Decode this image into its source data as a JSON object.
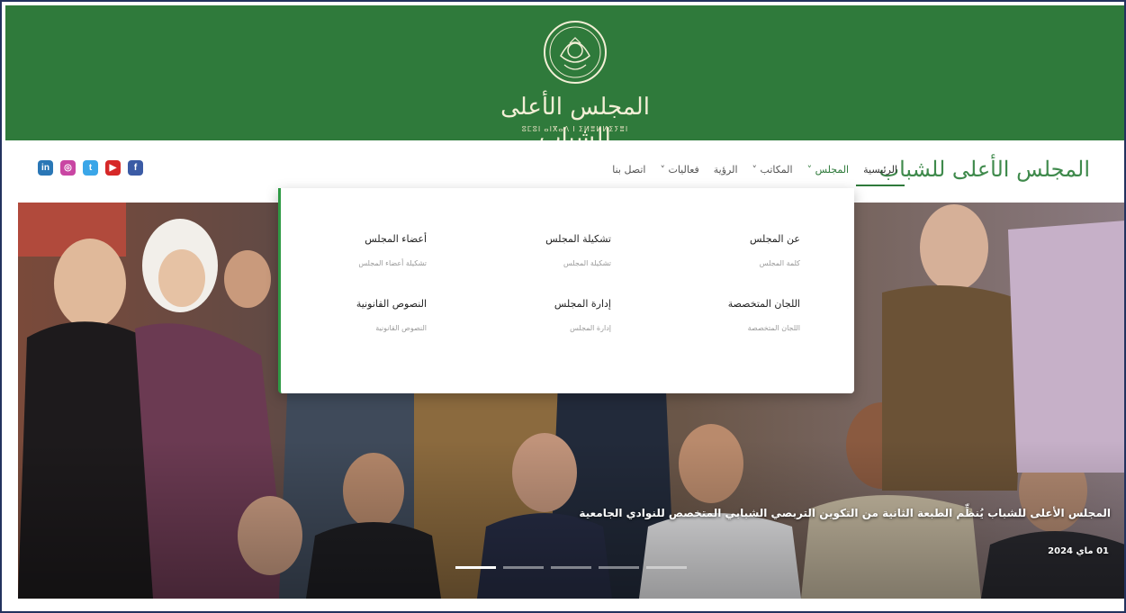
{
  "banner": {
    "title": "المجلس الأعلى للشباب",
    "subtitle": "ⵓⵎⵓⵏ ⴰⵏⴳⴰⴷ ⵏ ⵉⵍⴻⵍⵍⵉⵢⴻⵏ"
  },
  "nav": {
    "logo": "المجلس الأعلى للشباب",
    "items": [
      {
        "label": "الرئيسية"
      },
      {
        "label": "المجلس ˅"
      },
      {
        "label": "المكاتب ˅"
      },
      {
        "label": "الرؤية"
      },
      {
        "label": "فعاليات ˅"
      },
      {
        "label": "اتصل بنا"
      }
    ]
  },
  "social": [
    {
      "icon": "linkedin-icon",
      "glyph": "in",
      "color": "#2a77b6"
    },
    {
      "icon": "instagram-icon",
      "glyph": "◎",
      "color": "#c946a3"
    },
    {
      "icon": "twitter-icon",
      "glyph": "t",
      "color": "#3aa6e8"
    },
    {
      "icon": "youtube-icon",
      "glyph": "▶",
      "color": "#d62828"
    },
    {
      "icon": "facebook-icon",
      "glyph": "f",
      "color": "#3b5ba5"
    }
  ],
  "dropdown": {
    "items": [
      {
        "title": "عن المجلس",
        "sub": "كلمة المجلس"
      },
      {
        "title": "تشكيلة المجلس",
        "sub": "تشكيلة المجلس"
      },
      {
        "title": "أعضاء المجلس",
        "sub": "تشكيلة أعضاء المجلس"
      },
      {
        "title": "اللجان المتخصصة",
        "sub": "اللجان المتخصصة"
      },
      {
        "title": "إدارة المجلس",
        "sub": "إدارة المجلس"
      },
      {
        "title": "النصوص القانونية",
        "sub": "النصوص القانونية"
      }
    ]
  },
  "hero": {
    "caption": "المجلس الأعلى للشباب يُنظِّم الطبعة الثانية من التكوين التربصي الشبابي المتخصص للنوادي الجامعية",
    "date": "01 ماي 2024",
    "slides_total": 5,
    "active_slide": 1
  },
  "colors": {
    "brand_green": "#2f7a3b",
    "accent_green": "#2f9a45"
  }
}
